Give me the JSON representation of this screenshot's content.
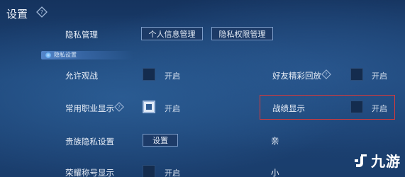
{
  "header": {
    "title": "设置"
  },
  "privacy_management": {
    "label": "隐私管理",
    "buttons": [
      "个人信息管理",
      "隐私权限管理"
    ]
  },
  "section": {
    "label": "隐私设置"
  },
  "settings": {
    "allow_spectate": {
      "label": "允许观战",
      "toggle": "开启",
      "checked": false
    },
    "friend_replay": {
      "label": "好友精彩回放",
      "toggle": "开启",
      "checked": false
    },
    "common_class": {
      "label": "常用职业显示",
      "toggle": "开启",
      "checked": true
    },
    "combat_record": {
      "label": "战绩显示",
      "toggle": "开启",
      "checked": false
    },
    "noble_privacy": {
      "label": "贵族隐私设置",
      "button": "设置"
    },
    "glory_title": {
      "label": "荣耀称号显示",
      "toggle": "开启",
      "checked": false
    }
  },
  "partial": {
    "right_label_1": "亲",
    "right_label_2": "小"
  },
  "watermark": {
    "text": "九游"
  },
  "colors": {
    "highlight": "#d8393a",
    "background": "#1d4578"
  }
}
